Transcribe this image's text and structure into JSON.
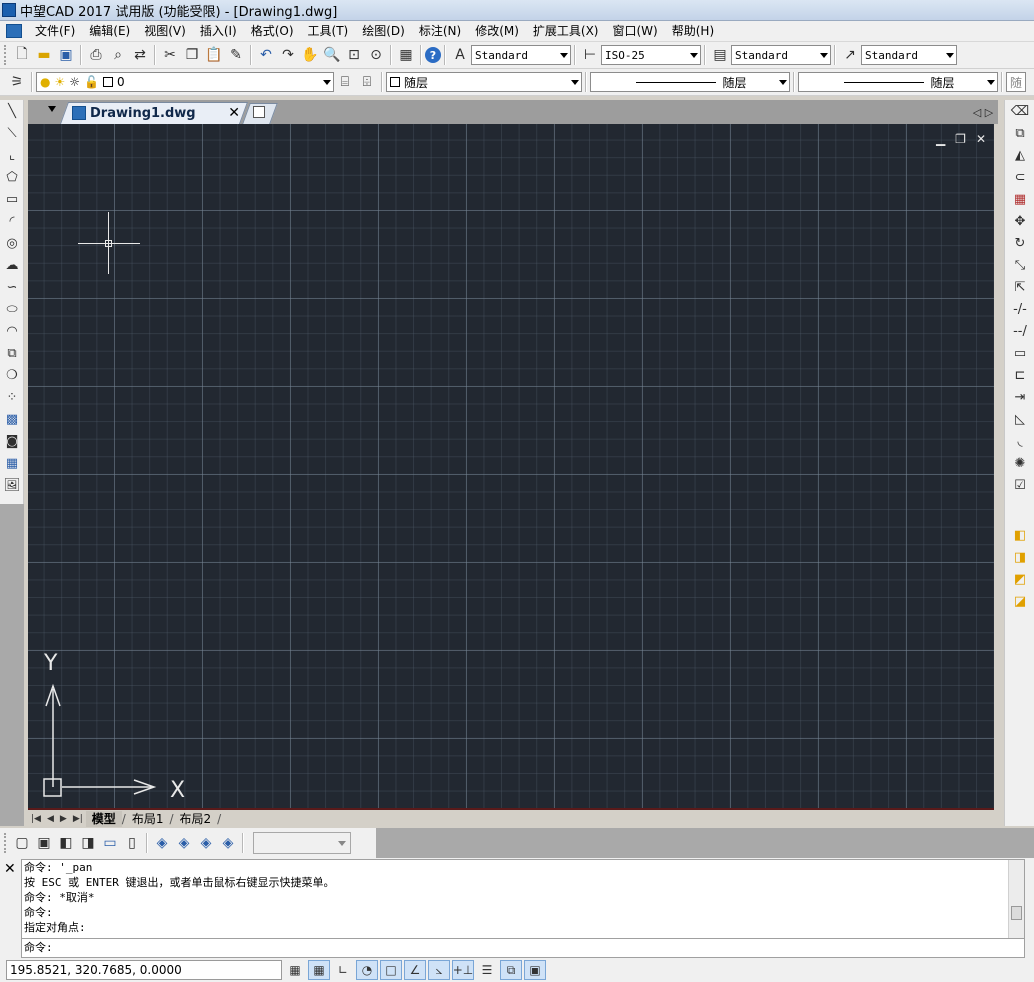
{
  "window": {
    "title": "中望CAD 2017 试用版 (功能受限) - [Drawing1.dwg]"
  },
  "menu": [
    "文件(F)",
    "编辑(E)",
    "视图(V)",
    "插入(I)",
    "格式(O)",
    "工具(T)",
    "绘图(D)",
    "标注(N)",
    "修改(M)",
    "扩展工具(X)",
    "窗口(W)",
    "帮助(H)"
  ],
  "styles": {
    "text_style": "Standard",
    "dim_style": "ISO-25",
    "table_style": "Standard",
    "multileader_style": "Standard",
    "extra": "随"
  },
  "layer": {
    "name": "0"
  },
  "properties": {
    "color": "随层",
    "linetype": "随层",
    "lineweight": "随层"
  },
  "doc_tab": {
    "label": "Drawing1.dwg"
  },
  "canvas": {
    "ucs_x": "X",
    "ucs_y": "Y"
  },
  "layout_tabs": [
    "模型",
    "布局1",
    "布局2"
  ],
  "command": {
    "history": [
      "命令: '_pan",
      "按 ESC 或 ENTER 键退出，或者单击鼠标右键显示快捷菜单。",
      "命令: *取消*",
      "命令:",
      "指定对角点:"
    ],
    "prompt": "命令:"
  },
  "status": {
    "coordinates": "195.8521, 320.7685, 0.0000"
  },
  "colors": {
    "canvas_bg": "#222831",
    "grid": "#5a6878"
  }
}
